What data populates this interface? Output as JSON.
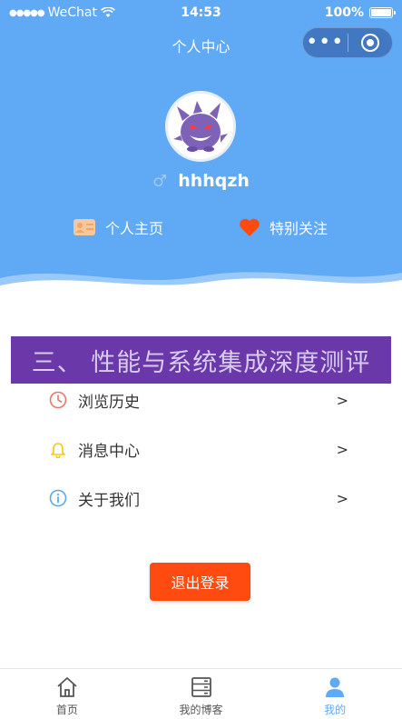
{
  "status_bar": {
    "carrier": "WeChat",
    "time": "14:53",
    "battery": "100%"
  },
  "navbar": {
    "title": "个人中心",
    "more_icon": "more-dots-icon",
    "close_icon": "target-circle-icon"
  },
  "profile": {
    "avatar_icon": "gengar-avatar",
    "gender_icon": "male-icon",
    "username": "hhhqzh"
  },
  "actions": {
    "homepage": {
      "label": "个人主页",
      "icon": "id-card-icon"
    },
    "follow": {
      "label": "特别关注",
      "icon": "heart-icon"
    }
  },
  "banner": {
    "text": "三、 性能与系统集成深度测评"
  },
  "menu": [
    {
      "label": "浏览历史",
      "icon": "clock-icon",
      "arrow": ">"
    },
    {
      "label": "消息中心",
      "icon": "bell-icon",
      "arrow": ">"
    },
    {
      "label": "关于我们",
      "icon": "info-icon",
      "arrow": ">"
    }
  ],
  "logout": {
    "label": "退出登录"
  },
  "tabbar": [
    {
      "label": "首页",
      "icon": "home-icon",
      "active": false
    },
    {
      "label": "我的博客",
      "icon": "server-icon",
      "active": false
    },
    {
      "label": "我的",
      "icon": "user-icon",
      "active": true
    }
  ],
  "colors": {
    "primary": "#60a9f5",
    "logout": "#ff4a10",
    "banner": "#6a38a8"
  }
}
